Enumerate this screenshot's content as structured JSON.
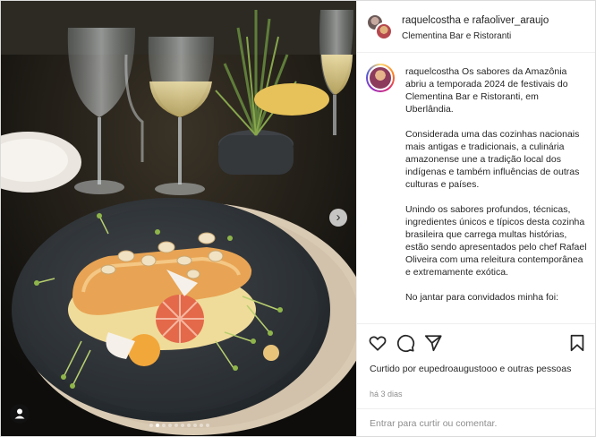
{
  "post_header": {
    "users": "raquelcosthа e rafaoliver_araujo",
    "location": "Clementina Bar e Ristoranti"
  },
  "caption": {
    "username": "raquelcostha",
    "paragraphs": [
      "Os sabores da Amazônia abriu a temporada 2024 de festivais do Clementina Bar e Ristoranti, em Uberlândia.",
      "Considerada uma das cozinhas nacionais mais antigas e tradicionais, a culinária amazonense une a tradição local dos indígenas e também influências de outras culturas e países.",
      "Unindo os sabores profundos, técnicas, ingredientes únicos e típicos desta cozinha brasileira que carrega multas histórias, estão sendo apresentados pelo chef Rafael Oliveira com uma releitura contemporânea e extremamente exótica.",
      "No jantar para convidados minha foi:"
    ]
  },
  "actions": {
    "like_icon": "heart-icon",
    "comment_icon": "comment-icon",
    "share_icon": "share-icon",
    "save_icon": "bookmark-icon"
  },
  "likes": {
    "text": "Curtido por eupedroaugustooo e outras pessoas"
  },
  "timestamp": "há 3 dias",
  "comment_box": {
    "placeholder": "Entrar para curtir ou comentar."
  },
  "carousel": {
    "next_icon": "chevron-right-icon",
    "tag_icon": "user-tag-icon",
    "slide_count": 10,
    "active_index": 1
  },
  "colors": {
    "text": "#262626",
    "muted": "#8e8e8e",
    "border": "#efefef"
  }
}
